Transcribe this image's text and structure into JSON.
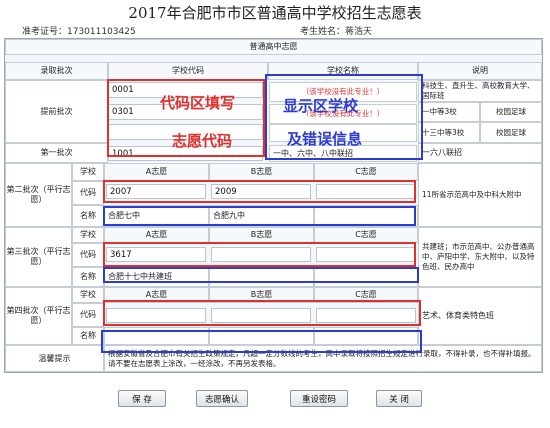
{
  "page": {
    "title": "2017年合肥市市区普通高中学校招生志愿表",
    "exam_id": "准考证号：173011103425",
    "student_name": "考生姓名：蒋浩天"
  },
  "table": {
    "caption": "普通高中志愿",
    "col_headers": {
      "batch": "录取批次",
      "code": "学校代码",
      "name": "学校名称",
      "note": "说明"
    },
    "early": {
      "label": "提前批次",
      "codes": [
        "0001",
        "0301"
      ],
      "msgs": [
        "（该学校没有此专业！）",
        "（该学校没有此专业！）"
      ],
      "notes": [
        "科技生、直升生、高校教育大学、国际班",
        "一中等3校",
        "校园足球",
        "十三中等3校",
        "校园足球"
      ]
    },
    "first": {
      "label": "第一批次",
      "code": "1001",
      "school": "一中、六中、八中联招",
      "note": "一六八联招"
    },
    "second": {
      "label": "第二批次（平行志愿）",
      "row_school": "学校",
      "row_code": "代码",
      "row_name": "名称",
      "headers": [
        "A志愿",
        "B志愿",
        "C志愿"
      ],
      "codes": [
        "2007",
        "2009",
        ""
      ],
      "names": [
        "合肥七中",
        "合肥九中",
        ""
      ],
      "note": "11所省示范高中及中科大附中"
    },
    "third": {
      "label": "第三批次（平行志愿）",
      "row_school": "学校",
      "row_code": "代码",
      "row_name": "名称",
      "headers": [
        "A志愿",
        "B志愿",
        "C志愿"
      ],
      "codes": [
        "3617",
        "",
        ""
      ],
      "names": [
        "合肥十七中共建班",
        "",
        ""
      ],
      "note": "共建班；市示范高中、公办普通高中、庐阳中学、东大附中、以及特色班、民办高中"
    },
    "fourth": {
      "label": "第四批次（平行志愿）",
      "row_school": "学校",
      "row_code": "代码",
      "row_name": "名称",
      "headers": [
        "A志愿",
        "B志愿",
        "C志愿"
      ],
      "note": "艺术、体育类特色班"
    },
    "tip": {
      "label": "温馨提示",
      "text": "根据安徽省及合肥市有关招生政策规定，凡超一定分数线的考生，高中录取将按照招生规定进行录取，不得补录，也不得补填报。请不要在志愿表上涂改，一经涂改，不再另发表格。"
    }
  },
  "annotations": {
    "red_a": "代码区填写",
    "red_b": "志愿代码",
    "blue_a": "显示区学校",
    "blue_b": "及错误信息"
  },
  "buttons": [
    "保 存",
    "志愿确认",
    "重设密码",
    "关 闭"
  ],
  "colors": {
    "annotation_red": "#e0302b",
    "annotation_blue": "#2c3bd0",
    "error_red": "#e53030"
  }
}
